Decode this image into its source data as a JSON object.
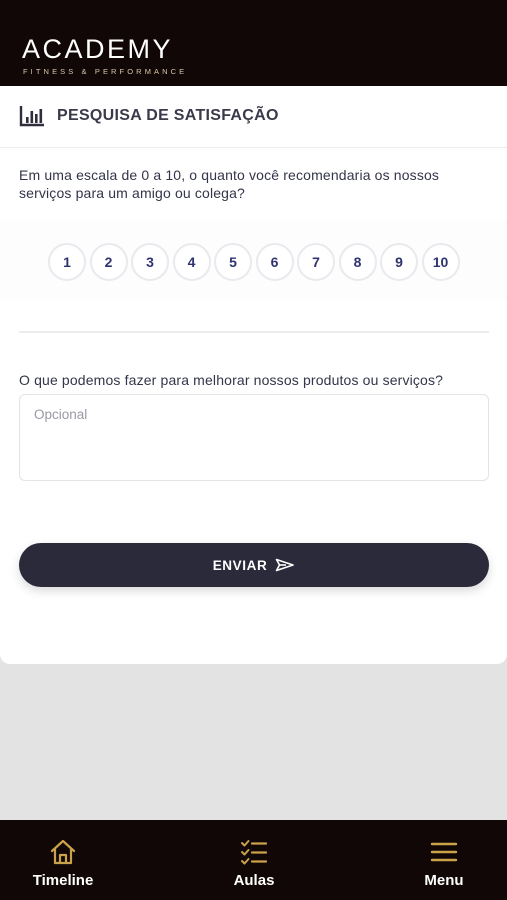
{
  "header": {
    "brand_title": "ACADEMY",
    "brand_subtitle": "FITNESS & PERFORMANCE"
  },
  "survey": {
    "title": "PESQUISA DE SATISFAÇÃO",
    "question1": "Em uma escala de 0 a 10, o quanto você recomendaria os nossos serviços para um amigo ou colega?",
    "scale": [
      "1",
      "2",
      "3",
      "4",
      "5",
      "6",
      "7",
      "8",
      "9",
      "10"
    ],
    "question2": "O que podemos fazer para melhorar nossos produtos ou serviços?",
    "feedback_placeholder": "Opcional",
    "submit_label": "ENVIAR"
  },
  "nav": {
    "timeline": "Timeline",
    "aulas": "Aulas",
    "menu": "Menu"
  },
  "colors": {
    "header_bg": "#120707",
    "accent_gold": "#c9a24a",
    "button_dark": "#2a2a3b",
    "scale_text": "#2f3470"
  }
}
